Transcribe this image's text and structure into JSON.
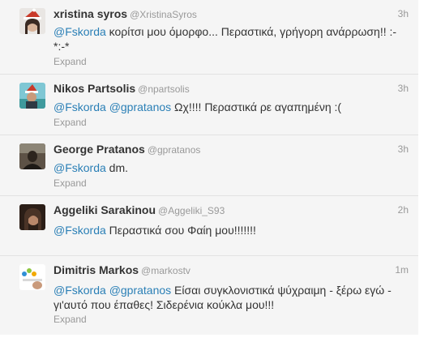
{
  "tweets": [
    {
      "fullname": "xristina syros",
      "username": "@XristinaSyros",
      "time": "3h",
      "lines": [
        [
          {
            "t": "@Fskorda",
            "m": true
          },
          {
            "t": " κορίτσι μου όμορφο... Περαστικά, γρήγορη ανάρρωση!! :-"
          }
        ],
        [
          {
            "t": "*:-*"
          }
        ]
      ],
      "expand": "Expand",
      "avatar_color": "#c93a2a"
    },
    {
      "fullname": "Nikos Partsolis",
      "username": "@npartsolis",
      "time": "3h",
      "lines": [
        [
          {
            "t": "@Fskorda",
            "m": true
          },
          {
            "t": " "
          },
          {
            "t": "@gpratanos",
            "m": true
          },
          {
            "t": " Ωχ!!!! Περαστικά ρε αγαπημένη :("
          }
        ]
      ],
      "expand": "Expand",
      "avatar_color": "#3f9a9d"
    },
    {
      "fullname": "George Pratanos",
      "username": "@gpratanos",
      "time": "3h",
      "lines": [
        [
          {
            "t": "@Fskorda",
            "m": true
          },
          {
            "t": " dm."
          }
        ]
      ],
      "expand": "Expand",
      "avatar_color": "#6e5a3c"
    },
    {
      "fullname": "Aggeliki Sarakinou",
      "username": "@Aggeliki_S93",
      "time": "2h",
      "lines": [
        [
          {
            "t": "@Fskorda",
            "m": true
          },
          {
            "t": " Περαστικά σου Φαίη μου!!!!!!!"
          }
        ]
      ],
      "expand": "Expand",
      "avatar_color": "#4a3326"
    },
    {
      "fullname": "Dimitris Markos",
      "username": "@markostv",
      "time": "1m",
      "lines": [
        [
          {
            "t": "@Fskorda",
            "m": true
          },
          {
            "t": " "
          },
          {
            "t": "@gpratanos",
            "m": true
          },
          {
            "t": " Είσαι συγκλονιστικά ψύχραιμη - ξέρω εγώ -"
          }
        ],
        [
          {
            "t": "γι'αυτό που έπαθες! Σιδερένια κούκλα μου!!!"
          }
        ]
      ],
      "expand": "Expand",
      "avatar_color": "#2f8fd6"
    }
  ]
}
